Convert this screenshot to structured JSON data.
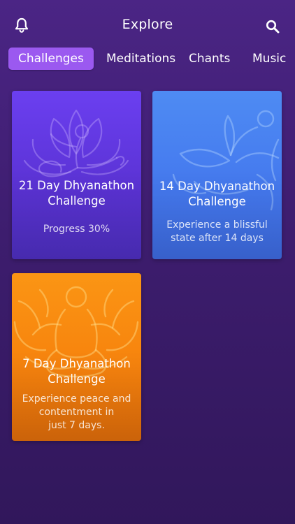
{
  "header": {
    "title": "Explore",
    "left_icon": "bell-icon",
    "right_icon": "search-icon"
  },
  "tabs": [
    {
      "label": "Challenges",
      "active": true
    },
    {
      "label": "Meditations",
      "active": false
    },
    {
      "label": "Chants",
      "active": false
    },
    {
      "label": "Music",
      "active": false
    }
  ],
  "cards": [
    {
      "title_line1": "21 Day Dhyanathon",
      "title_line2": "Challenge",
      "subtitle_line1": "Progress 30%",
      "subtitle_line2": "",
      "subtitle_line3": "",
      "color": "#6b3ff0",
      "progress_percent": 30
    },
    {
      "title_line1": "14 Day Dhyanathon",
      "title_line2": "Challenge",
      "subtitle_line1": "Experience a blissful",
      "subtitle_line2": "state after 14 days",
      "subtitle_line3": "",
      "color": "#4e8bf3"
    },
    {
      "title_line1": "7 Day Dhyanathon",
      "title_line2": "Challenge",
      "subtitle_line1": "Experience peace and",
      "subtitle_line2": "contentment in",
      "subtitle_line3": "just 7 days.",
      "color": "#fb9514"
    }
  ],
  "colors": {
    "background": "#3d1d6e",
    "active_tab": "#9b59f0"
  }
}
